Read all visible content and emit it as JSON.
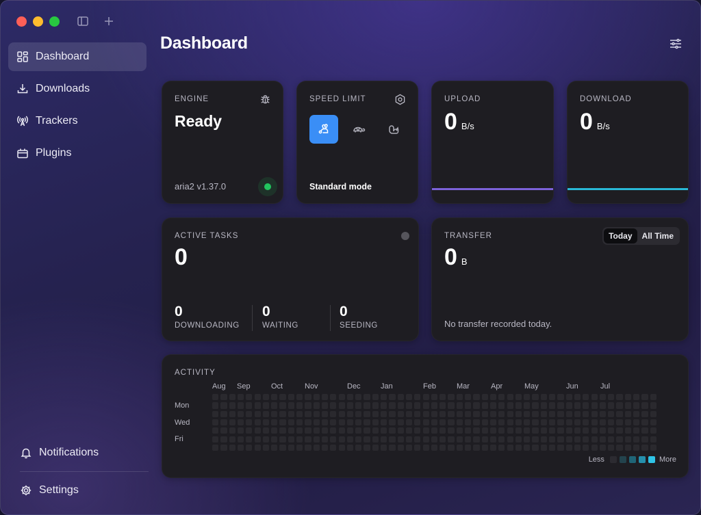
{
  "sidebar": {
    "items": [
      {
        "label": "Dashboard",
        "icon": "dashboard-grid-icon",
        "active": true
      },
      {
        "label": "Downloads",
        "icon": "download-tray-icon"
      },
      {
        "label": "Trackers",
        "icon": "antenna-icon"
      },
      {
        "label": "Plugins",
        "icon": "plugin-box-icon"
      }
    ],
    "bottom": [
      {
        "label": "Notifications",
        "icon": "bell-icon"
      },
      {
        "label": "Settings",
        "icon": "gear-icon"
      }
    ]
  },
  "page": {
    "title": "Dashboard"
  },
  "engine": {
    "label": "ENGINE",
    "status": "Ready",
    "version": "aria2 v1.37.0",
    "status_color": "#22c55e"
  },
  "speed_limit": {
    "label": "SPEED LIMIT",
    "mode": "Standard mode",
    "active_option": "standard"
  },
  "upload": {
    "label": "UPLOAD",
    "value": "0",
    "unit": "B/s",
    "color": "#7c62d9"
  },
  "download": {
    "label": "DOWNLOAD",
    "value": "0",
    "unit": "B/s",
    "color": "#29b8d6"
  },
  "active_tasks": {
    "label": "ACTIVE TASKS",
    "value": "0",
    "stats": [
      {
        "value": "0",
        "label": "DOWNLOADING"
      },
      {
        "value": "0",
        "label": "WAITING"
      },
      {
        "value": "0",
        "label": "SEEDING"
      }
    ]
  },
  "transfer": {
    "label": "TRANSFER",
    "value": "0",
    "unit": "B",
    "tabs": [
      {
        "label": "Today",
        "selected": true
      },
      {
        "label": "All Time",
        "selected": false
      }
    ],
    "message": "No transfer recorded today."
  },
  "activity": {
    "label": "ACTIVITY",
    "months": [
      "Aug",
      "Sep",
      "Oct",
      "Nov",
      "Dec",
      "Jan",
      "Feb",
      "Mar",
      "Apr",
      "May",
      "Jun",
      "Jul"
    ],
    "days": [
      "Mon",
      "Wed",
      "Fri"
    ],
    "legend_less": "Less",
    "legend_more": "More",
    "legend_colors": [
      "#2c2b31",
      "#23434d",
      "#1f6577",
      "#2590ad",
      "#2fc3e6"
    ],
    "empty_color": "#2a292e"
  }
}
